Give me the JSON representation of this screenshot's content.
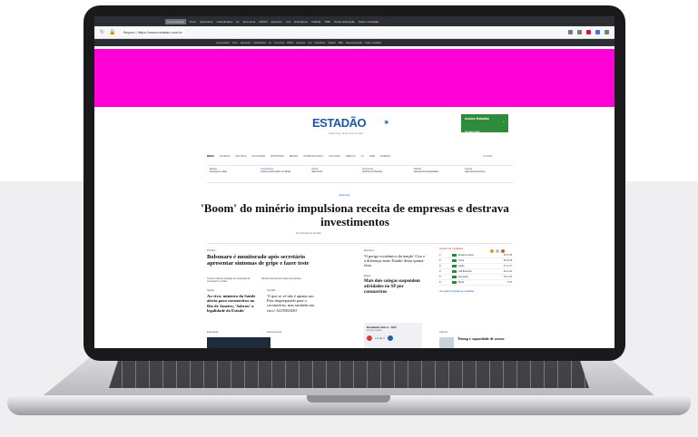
{
  "browser": {
    "bookmarks_top": [
      "Grupo Estado",
      "Verso",
      "Agricultura",
      "Classificados",
      "E+",
      "Economia",
      "RÁDIO",
      "Esportes",
      "Link",
      "Estudantes",
      "Paladar",
      "PME",
      "Saúde Educação",
      "Sobre o Estadão"
    ],
    "address": {
      "secure_label": "Seguro",
      "url": "https://www.estadao.com.br"
    },
    "bookmarks_sub": [
      "Grupo Estado",
      "Verso",
      "Agricultura",
      "Classificados",
      "E+",
      "Economia",
      "RÁDIO",
      "Esportes",
      "Link",
      "Estudantes",
      "Paladar",
      "PME",
      "Saúde Educação",
      "Sobre o Estadão"
    ]
  },
  "site": {
    "logo": "ESTADÃO",
    "tagline": "Quinta-feira, 12 de março de 2020",
    "promo": {
      "title": "Assine Estadão",
      "subtitle": "30 dias grátis"
    },
    "nav": [
      "MENU",
      "ÚLTIMAS",
      "POLÍTICA",
      "ECONOMIA",
      "ESPORTES",
      "BRASIL",
      "INTERNACIONAL",
      "CULTURA",
      "CIÊNCIA",
      "TV",
      "PME",
      "OPINIÃO"
    ],
    "tools_label": "Entrar",
    "strip": [
      {
        "label": "Bolsas",
        "text": "Ibovespa e dólar"
      },
      {
        "label": "Coronavírus",
        "text": "Casos confirmados no Brasil"
      },
      {
        "label": "Clima",
        "text": "São Paulo"
      },
      {
        "label": "Economia",
        "text": "Reforma Tributária"
      },
      {
        "label": "Política",
        "text": "Câmara dos Deputados"
      },
      {
        "label": "Cultura",
        "text": "Agenda da semana"
      }
    ],
    "main_tag": "Economia",
    "headline": "'Boom' do minério impulsiona receita de empresas e destrava investimentos",
    "byline": "Por Redação do Estadão",
    "col1": {
      "section": "Política",
      "title": "Bolsonaro é monitorado após secretário apresentar sintomas de gripe e fazer teste",
      "items": [
        "Governo discute medidas de contenção do coronavírus no País",
        "Câmara aprova texto-base da proposta"
      ],
      "section2": "Saúde",
      "story2": "Ao vivo: ministro da Saúde alerta para coronavírus no Rio de Janeiro; 'Sobrou' a legalidade do Estado'",
      "section3": "Educação"
    },
    "col2": {
      "section": "Opinião",
      "story2": "'O que se vê não é apenas um País despreparado para o coronavírus, mas também um risco' ALTERADO",
      "section2": "Internacional"
    },
    "col3": {
      "section": "Esportes",
      "story1": "'O perigo econômico da inação' Ciro e a diferença entre Estado' desta quinta-feira",
      "section2": "Brasil",
      "story2": "Mais dois colegas suspendem atividades no SP por coronavírus",
      "widget": {
        "title": "Brasileirão Série A - 2020",
        "subtitle": "Próxima rodada",
        "score": "x 2 de 3"
      }
    },
    "sidebar": {
      "title": "Quadro de medalhas",
      "rows": [
        {
          "pos": "1º",
          "name": "Estados Unidos",
          "score": "46 37 38"
        },
        {
          "pos": "2º",
          "name": "China",
          "score": "38 32 18"
        },
        {
          "pos": "3º",
          "name": "Japão",
          "score": "27 14 17"
        },
        {
          "pos": "4º",
          "name": "Grã-Bretanha",
          "score": "22 21 22"
        },
        {
          "pos": "5º",
          "name": "Alemanha",
          "score": "10 11 16"
        },
        {
          "pos": "6º",
          "name": "Brasil",
          "score": "7 6 8"
        }
      ],
      "link": "Ver quadro completo de medalhas",
      "section2": "Coluna",
      "story2": "Trump e capacidade de acesso"
    }
  }
}
